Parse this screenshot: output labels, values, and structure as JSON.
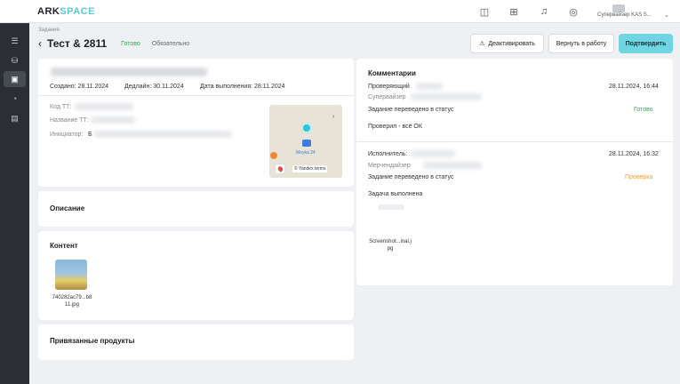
{
  "app": {
    "logo_main": "ARK",
    "logo_accent": "SPACE"
  },
  "header": {
    "user": "Супервайзер KAS S..."
  },
  "icons": {
    "sidebar": [
      "list-icon",
      "database-icon",
      "panel-icon",
      "pie-icon",
      "box-icon"
    ],
    "topbar": [
      "chat-icon",
      "grid-icon",
      "bell-icon",
      "compass-icon"
    ]
  },
  "breadcrumb": "Задания",
  "task": {
    "title": "Тест & 2811",
    "status": "Готово",
    "priority": "Обязательно",
    "created": "Создано: 28.11.2024",
    "deadline": "Дедлайн: 30.11.2024",
    "completed": "Дата выполнения: 28.11.2024",
    "code_label": "Код ТТ:",
    "name_label": "Название ТТ:",
    "initiator_label": "Инициатор:",
    "initiator_initial": "Б"
  },
  "actions": {
    "deactivate": "Деактивировать",
    "return": "Вернуть в работу",
    "confirm": "Подтвердить"
  },
  "map": {
    "place": "Moyka 24",
    "attribution": "© Yandex terms"
  },
  "sections": {
    "description": "Описание",
    "content": "Контент",
    "content_file": "740282ac79...b811.jpg",
    "products": "Привязанные продукты"
  },
  "comments": {
    "title": "Комментарии",
    "items": [
      {
        "role": "Проверяющий",
        "sub": "Супервайзер",
        "date": "28.11.2024, 16:44",
        "status_text": "Задание переведено в статус",
        "status": "Готово",
        "status_color": "#2fa84f",
        "message": "Проверил - всё ОК"
      },
      {
        "role": "Исполнитель:",
        "sub": "Мерчендайзер",
        "date": "28.11.2024, 16:32",
        "status_text": "Задание переведено в статус",
        "status": "Проверка",
        "status_color": "#f0a040",
        "message": "Задача выполнена",
        "file": "Screenshot...inal.jpg"
      }
    ]
  }
}
